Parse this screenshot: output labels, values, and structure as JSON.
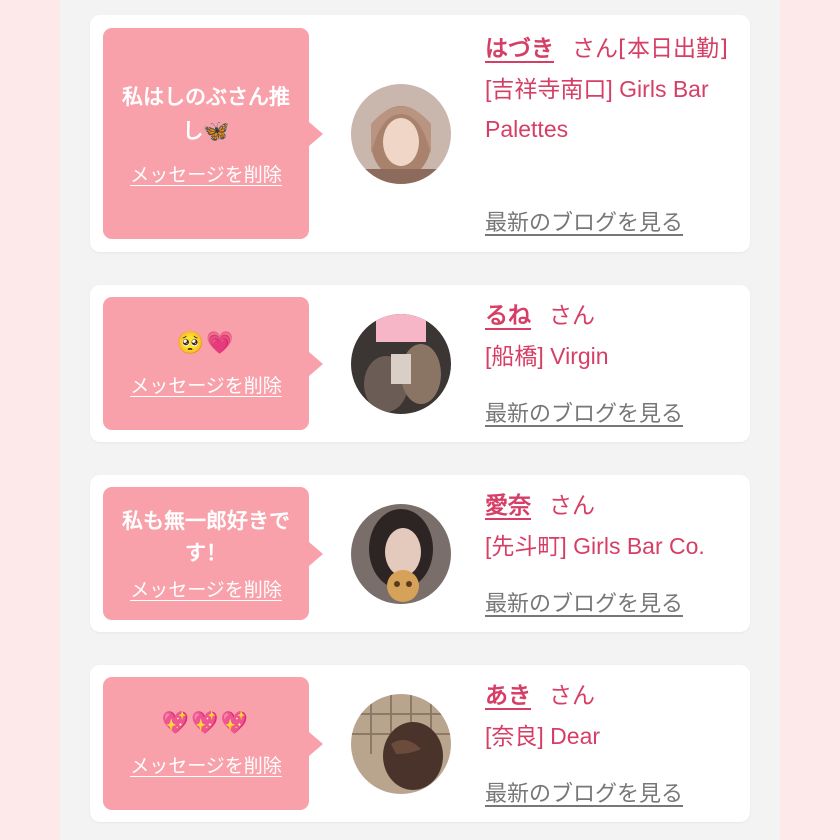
{
  "cards": [
    {
      "message": "私はしのぶさん推し🦋",
      "delete_label": "メッセージを削除",
      "name": "はづき",
      "honorific": "さん",
      "status": "[本日出勤]",
      "shop": "[吉祥寺南口] Girls Bar Palettes",
      "blog_label": "最新のブログを見る",
      "avatar": "avatar-photo"
    },
    {
      "message": "🥺💗",
      "delete_label": "メッセージを削除",
      "name": "るね",
      "honorific": "さん",
      "shop": "[船橋] Virgin",
      "blog_label": "最新のブログを見る",
      "avatar": "avatar-photo"
    },
    {
      "message": "私も無一郎好きです！",
      "delete_label": "メッセージを削除",
      "name": "愛奈",
      "honorific": "さん",
      "shop": "[先斗町] Girls Bar Co.",
      "blog_label": "最新のブログを見る",
      "avatar": "avatar-photo"
    },
    {
      "message": "💖💖💖",
      "delete_label": "メッセージを削除",
      "name": "あき",
      "honorific": "さん",
      "shop": "[奈良] Dear",
      "blog_label": "最新のブログを見る",
      "avatar": "avatar-photo"
    }
  ],
  "colors": {
    "page_bg": "#fde8ea",
    "column_bg": "#f3f3f3",
    "bubble": "#f8a1aa",
    "name_text": "#d63e65",
    "link_gray": "#777777"
  }
}
